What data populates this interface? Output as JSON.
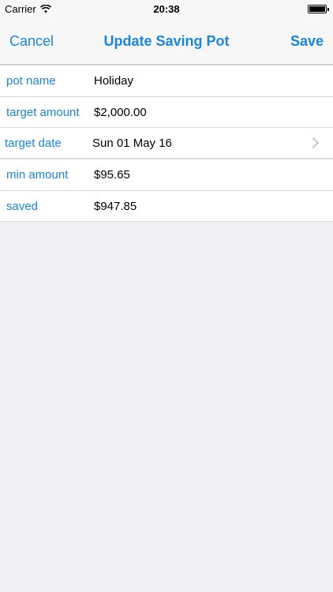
{
  "status_bar": {
    "carrier": "Carrier",
    "time": "20:38"
  },
  "nav": {
    "cancel_label": "Cancel",
    "title": "Update Saving Pot",
    "save_label": "Save"
  },
  "form": {
    "pot_name": {
      "label": "pot name",
      "value": "Holiday"
    },
    "target_amount": {
      "label": "target amount",
      "value": "$2,000.00"
    },
    "target_date": {
      "label": "target date",
      "value": "Sun 01 May 16"
    },
    "min_amount": {
      "label": "min amount",
      "value": "$95.65"
    },
    "saved": {
      "label": "saved",
      "value": "$947.85"
    }
  },
  "colors": {
    "accent": "#1a84e0",
    "background": "#efeff4"
  }
}
